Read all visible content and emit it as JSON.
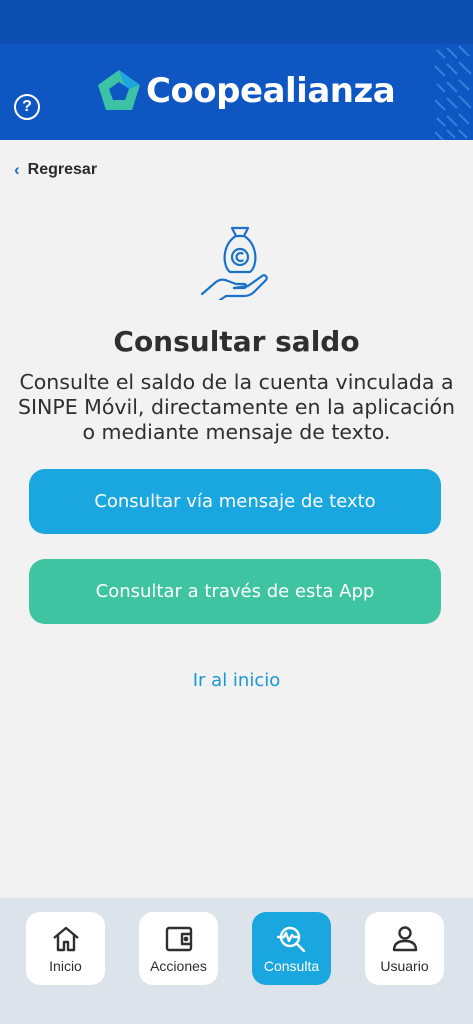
{
  "header": {
    "brand": "Coopealianza",
    "help_label": "?"
  },
  "nav_back": {
    "label": "Regresar",
    "chevron": "‹"
  },
  "main": {
    "icon": "money-bag-hand-icon",
    "title": "Consultar saldo",
    "description": "Consulte el saldo de la cuenta vinculada a SINPE Móvil, directamente en la aplicación o mediante mensaje de texto.",
    "sms_button": "Consultar vía mensaje de texto",
    "app_button": "Consultar a través de esta App",
    "home_link": "Ir al inicio"
  },
  "bottom_nav": {
    "items": [
      {
        "label": "Inicio",
        "icon": "home-icon"
      },
      {
        "label": "Acciones",
        "icon": "wallet-icon"
      },
      {
        "label": "Consulta",
        "icon": "search-pulse-icon",
        "active": true
      },
      {
        "label": "Usuario",
        "icon": "user-icon"
      }
    ]
  },
  "colors": {
    "header": "#0e56c2",
    "primary_button": "#1aa7e0",
    "secondary_button": "#3fc4a2",
    "link": "#1a97d4"
  }
}
